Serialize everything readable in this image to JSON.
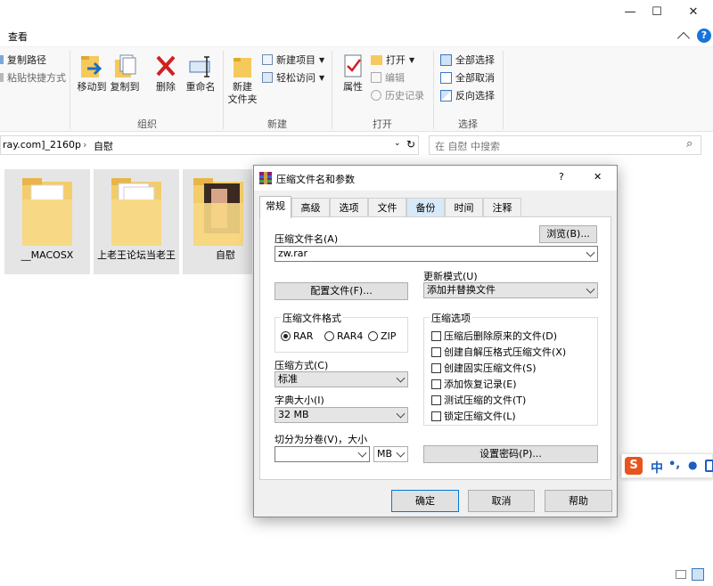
{
  "window": {
    "minimize": "—",
    "maximize": "☐",
    "close": "✕"
  },
  "ribbon": {
    "tab_view": "查看",
    "copy_path": "复制路径",
    "paste_shortcut": "粘贴快捷方式",
    "move_to": "移动到",
    "copy_to": "复制到",
    "delete": "删除",
    "rename": "重命名",
    "new_folder_line1": "新建",
    "new_folder_line2": "文件夹",
    "new_item": "新建项目",
    "easy_access": "轻松访问",
    "properties": "属性",
    "open": "打开",
    "edit": "编辑",
    "history": "历史记录",
    "select_all": "全部选择",
    "select_none": "全部取消",
    "invert_selection": "反向选择",
    "group_organize": "组织",
    "group_new": "新建",
    "group_open": "打开",
    "group_select": "选择"
  },
  "address": {
    "path_part1": "ray.com]_2160p",
    "path_part2": "自慰"
  },
  "search": {
    "placeholder": "在 自慰 中搜索"
  },
  "folders": [
    {
      "label": "__MACOSX"
    },
    {
      "label": "上老王论坛当老王"
    },
    {
      "label": "自慰"
    }
  ],
  "dialog": {
    "title": "压缩文件名和参数",
    "help": "?",
    "close": "✕",
    "tabs": [
      "常规",
      "高级",
      "选项",
      "文件",
      "备份",
      "时间",
      "注释"
    ],
    "archive_name_label": "压缩文件名(A)",
    "browse_button": "浏览(B)...",
    "archive_name_value": "zw.rar",
    "profiles_button": "配置文件(F)...",
    "update_mode_label": "更新模式(U)",
    "update_mode_value": "添加并替换文件",
    "format_group": "压缩文件格式",
    "format_rar": "RAR",
    "format_rar4": "RAR4",
    "format_zip": "ZIP",
    "options_group": "压缩选项",
    "options": [
      "压缩后删除原来的文件(D)",
      "创建自解压格式压缩文件(X)",
      "创建固实压缩文件(S)",
      "添加恢复记录(E)",
      "测试压缩的文件(T)",
      "锁定压缩文件(L)"
    ],
    "method_label": "压缩方式(C)",
    "method_value": "标准",
    "dict_label": "字典大小(I)",
    "dict_value": "32 MB",
    "split_label": "切分为分卷(V)，大小",
    "split_unit": "MB",
    "password_button": "设置密码(P)...",
    "ok": "确定",
    "cancel": "取消",
    "help_button": "帮助"
  },
  "ime": {
    "logo": "S",
    "mode": "中",
    "punct": "•,",
    "mic": "🎤"
  },
  "colors": {
    "accent": "#0078d7",
    "selection": "#cce8ff",
    "ok_border": "#0078d7"
  }
}
